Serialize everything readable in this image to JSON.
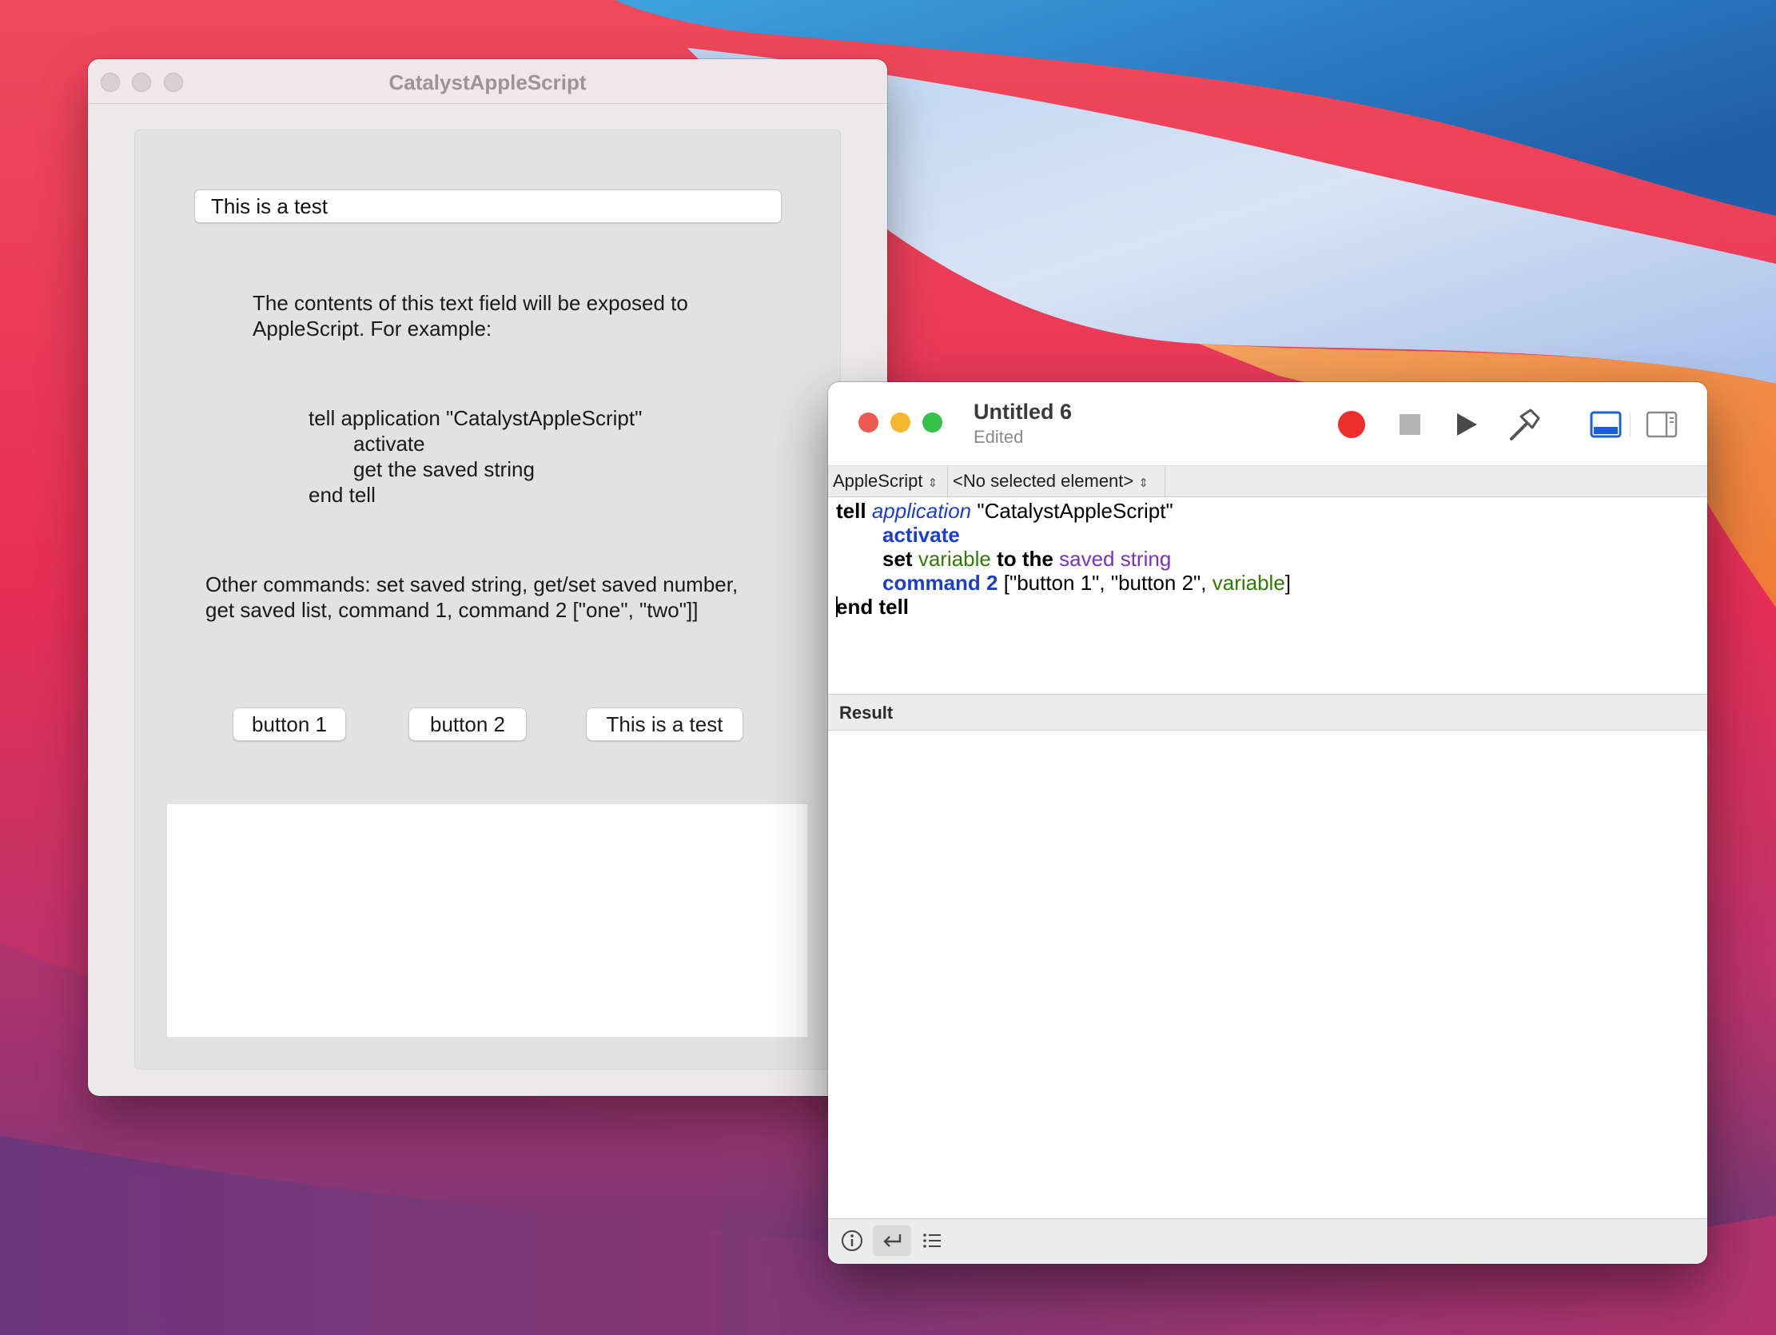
{
  "catalyst_window": {
    "title": "CatalystAppleScript",
    "text_field_value": "This is a test",
    "description_line_1": "The contents of this text field will be exposed to",
    "description_line_2": "AppleScript. For example:",
    "example_lines": [
      "tell application \"CatalystAppleScript\"",
      "activate",
      "get the saved string",
      "end tell"
    ],
    "other_commands_line_1": "Other commands: set saved string, get/set saved number,",
    "other_commands_line_2": "get saved list, command 1, command 2 [\"one\", \"two\"]]",
    "buttons": [
      "button 1",
      "button 2",
      "This is a test"
    ]
  },
  "script_editor": {
    "title": "Untitled 6",
    "subtitle": "Edited",
    "toolbar_icons": [
      "record-icon",
      "stop-icon",
      "run-icon",
      "compile-icon",
      "show-log-icon",
      "show-inspector-icon"
    ],
    "language_selector": "AppleScript",
    "element_selector": "<No selected element>",
    "code": {
      "l1_tell": "tell",
      "l1_app": "application",
      "l1_str": "\"CatalystAppleScript\"",
      "l2_activate": "activate",
      "l3_set": "set",
      "l3_var": "variable",
      "l3_tothe": "to the",
      "l3_prop": "saved string",
      "l4_cmd": "command 2",
      "l4_list_a": "[\"button 1\", \"button 2\",",
      "l4_var": "variable",
      "l4_close": "]",
      "l5_end": "end tell"
    },
    "result_label": "Result",
    "bottom_icons": [
      "info-icon",
      "return-icon",
      "list-icon"
    ]
  },
  "colors": {
    "close": "#ee5a52",
    "minimize": "#f5b72e",
    "zoom": "#33c148",
    "record": "#ec2f2a",
    "accent": "#1a5fd6"
  }
}
